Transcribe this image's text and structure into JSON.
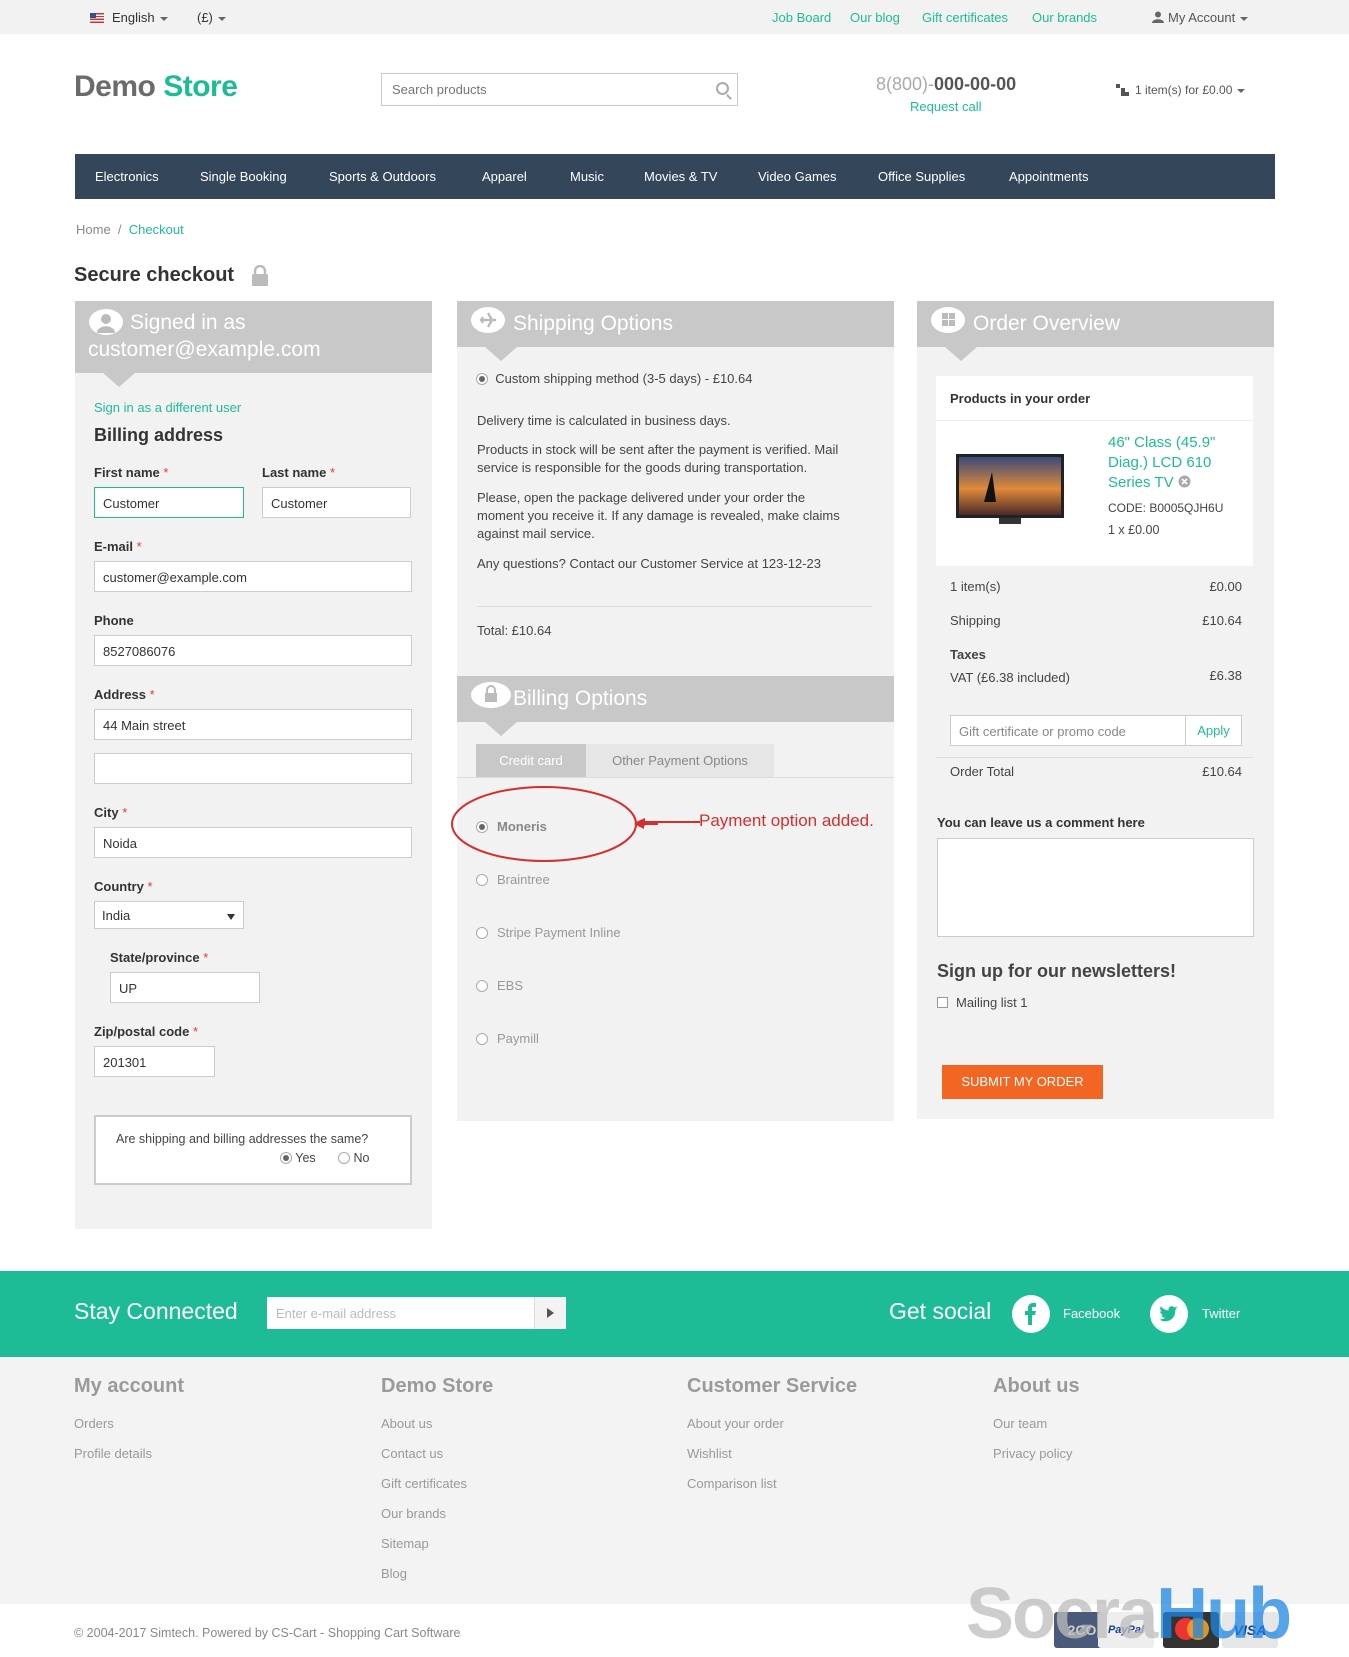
{
  "topbar": {
    "language": "English",
    "currency": "(£)",
    "links": [
      "Job Board",
      "Our blog",
      "Gift certificates",
      "Our brands"
    ],
    "account": "My Account"
  },
  "header": {
    "logo_part1": "Demo",
    "logo_part2": "Store",
    "search_placeholder": "Search products",
    "phone_prefix": "8(800)-",
    "phone_number": "000-00-00",
    "request_call": "Request call",
    "cart": "1 item(s) for £0.00"
  },
  "nav": [
    "Electronics",
    "Single Booking",
    "Sports & Outdoors",
    "Apparel",
    "Music",
    "Movies & TV",
    "Video Games",
    "Office Supplies",
    "Appointments"
  ],
  "breadcrumb": {
    "home": "Home",
    "sep": "/",
    "current": "Checkout"
  },
  "page_title": "Secure checkout",
  "billing": {
    "header_line1": "Signed in as",
    "header_line2": "customer@example.com",
    "sign_in_diff": "Sign in as a different user",
    "title": "Billing address",
    "first_name_label": "First name",
    "first_name": "Customer",
    "last_name_label": "Last name",
    "last_name": "Customer",
    "email_label": "E-mail",
    "email": "customer@example.com",
    "phone_label": "Phone",
    "phone": "8527086076",
    "address_label": "Address",
    "address": "44 Main street",
    "address2": "",
    "city_label": "City",
    "city": "Noida",
    "country_label": "Country",
    "country": "India",
    "state_label": "State/province",
    "state": "UP",
    "zip_label": "Zip/postal code",
    "zip": "201301",
    "same_question": "Are shipping and billing addresses the same?",
    "yes": "Yes",
    "no": "No",
    "star": "*"
  },
  "shipping": {
    "title": "Shipping Options",
    "method": "Custom shipping method (3-5 days) - £10.64",
    "p1": "Delivery time is calculated in business days.",
    "p2": "Products in stock will be sent after the payment is verified. Mail service is responsible for the goods during transportation.",
    "p3": "Please, open the package delivered under your order the moment you receive it. If any damage is revealed, make claims against mail service.",
    "p4": "Any questions? Contact our Customer Service at 123-12-23",
    "total": "Total: £10.64"
  },
  "billing_options": {
    "title": "Billing Options",
    "tab_credit": "Credit card",
    "tab_other": "Other Payment Options",
    "options": [
      "Moneris",
      "Braintree",
      "Stripe Payment Inline",
      "EBS",
      "Paymill"
    ],
    "annotation": "Payment option added."
  },
  "order": {
    "title": "Order Overview",
    "products_heading": "Products in your order",
    "product_name": "46\" Class (45.9\" Diag.) LCD 610 Series TV",
    "product_code": "CODE: B0005QJH6U",
    "product_qty": "1 x £0.00",
    "items_label": "1 item(s)",
    "items_value": "£0.00",
    "shipping_label": "Shipping",
    "shipping_value": "£10.64",
    "taxes_label": "Taxes",
    "vat_label": "VAT (£6.38 included)",
    "vat_value": "£6.38",
    "promo_placeholder": "Gift certificate or promo code",
    "apply": "Apply",
    "total_label": "Order Total",
    "total_value": "£10.64",
    "comment_label": "You can leave us a comment here",
    "newsletter_title": "Sign up for our newsletters!",
    "mailing_list": "Mailing list 1",
    "submit": "SUBMIT MY ORDER"
  },
  "footer": {
    "stay_connected": "Stay Connected",
    "email_placeholder": "Enter e-mail address",
    "get_social": "Get social",
    "facebook": "Facebook",
    "twitter": "Twitter",
    "col1_title": "My account",
    "col1": [
      "Orders",
      "Profile details"
    ],
    "col2_title": "Demo Store",
    "col2": [
      "About us",
      "Contact us",
      "Gift certificates",
      "Our brands",
      "Sitemap",
      "Blog"
    ],
    "col3_title": "Customer Service",
    "col3": [
      "About your order",
      "Wishlist",
      "Comparison list"
    ],
    "col4_title": "About us",
    "col4": [
      "Our team",
      "Privacy policy"
    ],
    "copyright": "© 2004-2017 Simtech.  Powered by CS-Cart - Shopping Cart Software",
    "watermark": "SocraHub",
    "payment_logos": [
      "2CO",
      "PayPal",
      "Mastercard",
      "VISA"
    ]
  },
  "colors": {
    "accent": "#1ebc96",
    "nav": "#34465a",
    "submit": "#f26522",
    "panel": "#f2f2f2",
    "panel_header": "#c8c8c8",
    "annotation": "#d32f2f"
  }
}
